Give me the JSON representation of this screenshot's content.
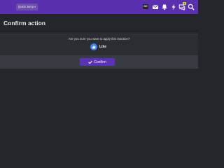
{
  "header": {
    "quick_links_label": "Quick Jump",
    "quick_links_caret": "▾",
    "avatar_initials": "DH",
    "icons": [
      "envelope-icon",
      "bell-icon",
      "bolt-icon",
      "chat-icon",
      "search-icon"
    ],
    "alerts_badge": "1"
  },
  "page": {
    "title": "Confirm action",
    "question": "Are you sure you want to apply this reaction?",
    "reaction_label": "Like",
    "reaction_icon": "thumbs-up-icon",
    "confirm_label": "Confirm",
    "confirm_icon": "check-icon"
  },
  "colors": {
    "header": "#5a2fb0",
    "background": "#24262b",
    "button": "#5a32b5",
    "like": "#3f82e8",
    "badge": "#c6d63a"
  }
}
